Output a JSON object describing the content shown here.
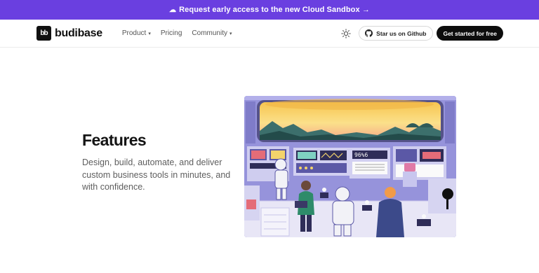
{
  "banner": {
    "text": "Request early access to the new Cloud Sandbox →",
    "icon": "cloud-icon"
  },
  "nav": {
    "logo_text": "budibase",
    "logo_mark": "bb",
    "links": [
      {
        "label": "Product",
        "dropdown": true
      },
      {
        "label": "Pricing",
        "dropdown": false
      },
      {
        "label": "Community",
        "dropdown": true
      }
    ],
    "github_label": "Star us on Github",
    "cta_label": "Get started for free"
  },
  "hero": {
    "title": "Features",
    "subtitle": "Design, build, automate, and deliver custom business tools in minutes, and with confidence."
  },
  "colors": {
    "banner": "#6a3fe0",
    "cta": "#0d0d0d",
    "illustration_bg": "#8e8bd6"
  }
}
